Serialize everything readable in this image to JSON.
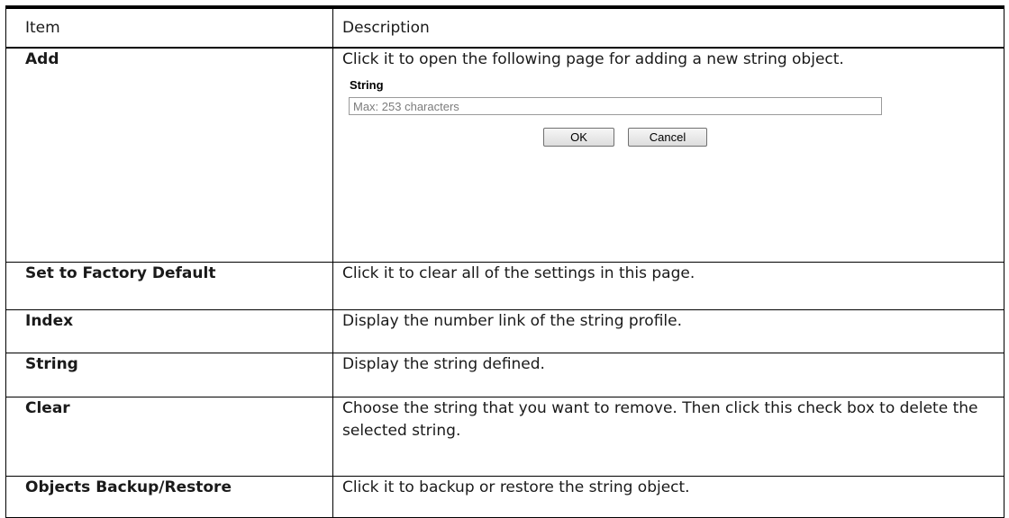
{
  "header": {
    "item": "Item",
    "description": "Description"
  },
  "rows": [
    {
      "item": "Add",
      "description": "Click it to open the following page for adding a new string object."
    },
    {
      "item": "Set to Factory Default",
      "description": "Click it to clear all of the settings in this page."
    },
    {
      "item": "Index",
      "description": "Display the number link of the string profile."
    },
    {
      "item": "String",
      "description": "Display the string defined."
    },
    {
      "item": "Clear",
      "description": "Choose the string that you want to remove. Then click this check box to delete the selected string."
    },
    {
      "item": "Objects Backup/Restore",
      "description": "Click it to backup or restore the string object."
    }
  ],
  "string_form": {
    "label": "String",
    "placeholder": "Max: 253 characters",
    "ok_label": "OK",
    "cancel_label": "Cancel"
  }
}
